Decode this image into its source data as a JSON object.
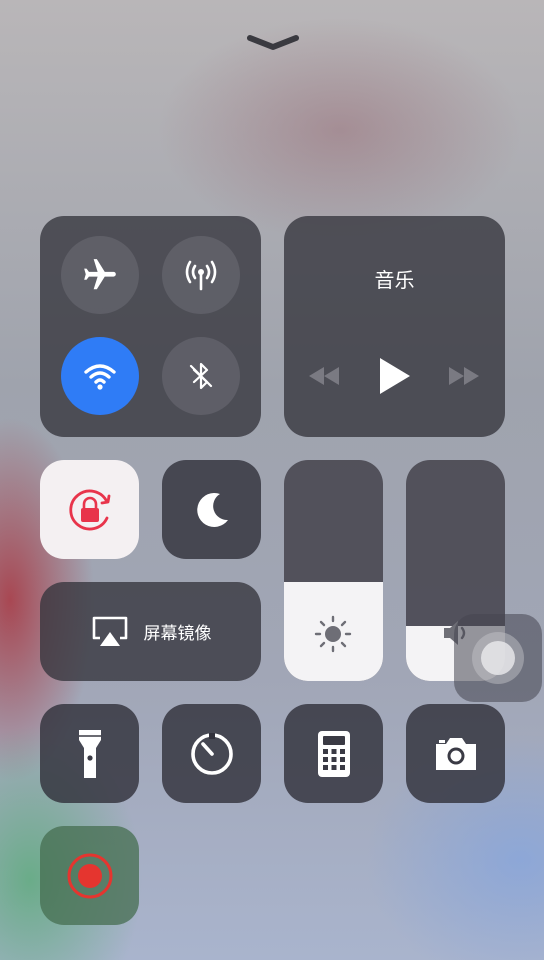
{
  "music": {
    "title": "音乐"
  },
  "screen_mirroring": {
    "label": "屏幕镜像"
  },
  "connectivity": {
    "airplane_mode": false,
    "cellular_data": false,
    "wifi": true,
    "bluetooth": false
  },
  "brightness": {
    "level": 0.45
  },
  "volume": {
    "level": 0.25
  },
  "colors": {
    "wifi_active": "#2f7cf6",
    "rotation_lock_active": "#e8344b",
    "record": "#e5352f"
  },
  "icons": [
    "chevron-down-icon",
    "airplane-icon",
    "antenna-icon",
    "wifi-icon",
    "bluetooth-icon",
    "rewind-icon",
    "play-icon",
    "fast-forward-icon",
    "rotation-lock-icon",
    "moon-icon",
    "airplay-icon",
    "sun-icon",
    "speaker-icon",
    "flashlight-icon",
    "timer-icon",
    "calculator-icon",
    "camera-icon",
    "record-icon"
  ]
}
